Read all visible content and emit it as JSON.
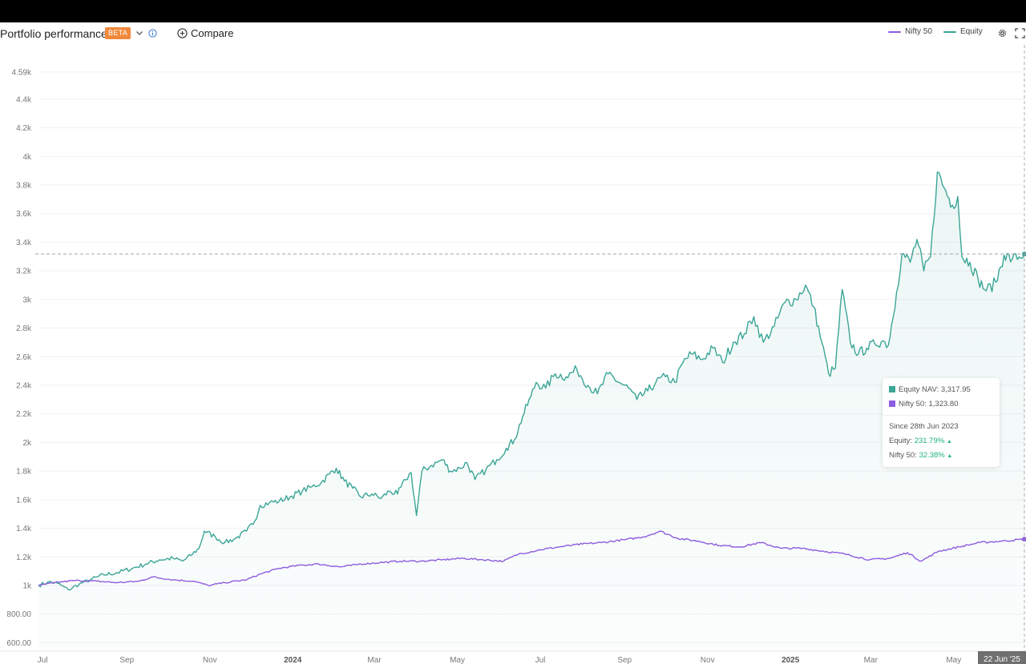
{
  "header": {
    "title": "Portfolio performance",
    "badge": "BETA",
    "compare_label": "Compare"
  },
  "legend": [
    {
      "name": "Nifty 50",
      "color": "#8e5cde"
    },
    {
      "name": "Equity",
      "color": "#3ba596"
    }
  ],
  "icons": {
    "dropdown": "chevron-down-icon",
    "info": "info-icon",
    "compare": "plus-circle-icon",
    "settings": "gear-icon",
    "fullscreen": "fullscreen-icon"
  },
  "tooltip": {
    "equity_label": "Equity NAV:",
    "equity_value": "3,317.95",
    "nifty_label": "Nifty 50:",
    "nifty_value": "1,323.80",
    "since_label": "Since 28th Jun 2023",
    "equity_return_label": "Equity:",
    "equity_return": "231.79%",
    "nifty_return_label": "Nifty 50:",
    "nifty_return": "32.38%",
    "up_arrow": "▲"
  },
  "chart_data": {
    "type": "line",
    "title": "",
    "xlabel": "",
    "ylabel": "",
    "ylim": [
      580,
      4650
    ],
    "x_range": [
      "2023-06-28",
      "2025-06-22"
    ],
    "y_ticks": [
      {
        "value": 600,
        "label": "600.00"
      },
      {
        "value": 800,
        "label": "800.00"
      },
      {
        "value": 1000,
        "label": "1k"
      },
      {
        "value": 1200,
        "label": "1.2k"
      },
      {
        "value": 1400,
        "label": "1.4k"
      },
      {
        "value": 1600,
        "label": "1.6k"
      },
      {
        "value": 1800,
        "label": "1.8k"
      },
      {
        "value": 2000,
        "label": "2k"
      },
      {
        "value": 2200,
        "label": "2.2k"
      },
      {
        "value": 2400,
        "label": "2.4k"
      },
      {
        "value": 2600,
        "label": "2.6k"
      },
      {
        "value": 2800,
        "label": "2.8k"
      },
      {
        "value": 3000,
        "label": "3k"
      },
      {
        "value": 3200,
        "label": "3.2k"
      },
      {
        "value": 3400,
        "label": "3.4k"
      },
      {
        "value": 3600,
        "label": "3.6k"
      },
      {
        "value": 3800,
        "label": "3.8k"
      },
      {
        "value": 4000,
        "label": "4k"
      },
      {
        "value": 4200,
        "label": "4.2k"
      },
      {
        "value": 4400,
        "label": "4.4k"
      },
      {
        "value": 4590,
        "label": "4.59k"
      }
    ],
    "x_ticks": [
      {
        "date": "2023-07-01",
        "label": "Jul",
        "bold": false
      },
      {
        "date": "2023-09-01",
        "label": "Sep",
        "bold": false
      },
      {
        "date": "2023-11-01",
        "label": "Nov",
        "bold": false
      },
      {
        "date": "2024-01-01",
        "label": "2024",
        "bold": true
      },
      {
        "date": "2024-03-01",
        "label": "Mar",
        "bold": false
      },
      {
        "date": "2024-05-01",
        "label": "May",
        "bold": false
      },
      {
        "date": "2024-07-01",
        "label": "Jul",
        "bold": false
      },
      {
        "date": "2024-09-01",
        "label": "Sep",
        "bold": false
      },
      {
        "date": "2024-11-01",
        "label": "Nov",
        "bold": false
      },
      {
        "date": "2025-01-01",
        "label": "2025",
        "bold": true
      },
      {
        "date": "2025-03-01",
        "label": "Mar",
        "bold": false
      },
      {
        "date": "2025-05-01",
        "label": "May",
        "bold": false
      }
    ],
    "crosshair": {
      "date": "2025-06-22",
      "label": "22 Jun '25",
      "value": 3317.95
    },
    "grid": true,
    "legend_position": "top-right",
    "series": [
      {
        "name": "Equity",
        "color": "#3ba596",
        "area": true,
        "points": [
          [
            "2023-06-28",
            1000
          ],
          [
            "2023-07-05",
            1025
          ],
          [
            "2023-07-12",
            1015
          ],
          [
            "2023-07-20",
            970
          ],
          [
            "2023-07-28",
            1010
          ],
          [
            "2023-08-05",
            1040
          ],
          [
            "2023-08-15",
            1075
          ],
          [
            "2023-08-25",
            1090
          ],
          [
            "2023-09-05",
            1120
          ],
          [
            "2023-09-15",
            1150
          ],
          [
            "2023-09-25",
            1180
          ],
          [
            "2023-10-05",
            1190
          ],
          [
            "2023-10-12",
            1170
          ],
          [
            "2023-10-18",
            1210
          ],
          [
            "2023-10-24",
            1260
          ],
          [
            "2023-10-28",
            1380
          ],
          [
            "2023-11-05",
            1340
          ],
          [
            "2023-11-12",
            1300
          ],
          [
            "2023-11-20",
            1330
          ],
          [
            "2023-11-28",
            1380
          ],
          [
            "2023-12-04",
            1450
          ],
          [
            "2023-12-08",
            1560
          ],
          [
            "2023-12-15",
            1580
          ],
          [
            "2023-12-22",
            1590
          ],
          [
            "2023-12-30",
            1620
          ],
          [
            "2024-01-08",
            1660
          ],
          [
            "2024-01-15",
            1690
          ],
          [
            "2024-01-22",
            1720
          ],
          [
            "2024-01-28",
            1780
          ],
          [
            "2024-02-02",
            1820
          ],
          [
            "2024-02-08",
            1730
          ],
          [
            "2024-02-14",
            1680
          ],
          [
            "2024-02-20",
            1620
          ],
          [
            "2024-02-28",
            1640
          ],
          [
            "2024-03-06",
            1610
          ],
          [
            "2024-03-12",
            1660
          ],
          [
            "2024-03-18",
            1640
          ],
          [
            "2024-03-24",
            1740
          ],
          [
            "2024-03-28",
            1790
          ],
          [
            "2024-04-01",
            1490
          ],
          [
            "2024-04-05",
            1800
          ],
          [
            "2024-04-12",
            1840
          ],
          [
            "2024-04-20",
            1880
          ],
          [
            "2024-04-26",
            1800
          ],
          [
            "2024-05-03",
            1820
          ],
          [
            "2024-05-08",
            1860
          ],
          [
            "2024-05-14",
            1740
          ],
          [
            "2024-05-22",
            1810
          ],
          [
            "2024-05-30",
            1880
          ],
          [
            "2024-06-06",
            1960
          ],
          [
            "2024-06-12",
            2020
          ],
          [
            "2024-06-18",
            2180
          ],
          [
            "2024-06-24",
            2320
          ],
          [
            "2024-06-28",
            2420
          ],
          [
            "2024-07-05",
            2380
          ],
          [
            "2024-07-12",
            2480
          ],
          [
            "2024-07-20",
            2460
          ],
          [
            "2024-07-28",
            2510
          ],
          [
            "2024-08-05",
            2400
          ],
          [
            "2024-08-12",
            2340
          ],
          [
            "2024-08-20",
            2480
          ],
          [
            "2024-08-28",
            2420
          ],
          [
            "2024-09-04",
            2380
          ],
          [
            "2024-09-10",
            2300
          ],
          [
            "2024-09-18",
            2360
          ],
          [
            "2024-09-24",
            2420
          ],
          [
            "2024-10-01",
            2460
          ],
          [
            "2024-10-08",
            2420
          ],
          [
            "2024-10-14",
            2560
          ],
          [
            "2024-10-20",
            2620
          ],
          [
            "2024-10-28",
            2580
          ],
          [
            "2024-11-05",
            2660
          ],
          [
            "2024-11-12",
            2560
          ],
          [
            "2024-11-20",
            2700
          ],
          [
            "2024-11-28",
            2760
          ],
          [
            "2024-12-05",
            2880
          ],
          [
            "2024-12-12",
            2700
          ],
          [
            "2024-12-20",
            2810
          ],
          [
            "2024-12-28",
            2980
          ],
          [
            "2025-01-05",
            3000
          ],
          [
            "2025-01-12",
            3100
          ],
          [
            "2025-01-18",
            2950
          ],
          [
            "2025-01-24",
            2700
          ],
          [
            "2025-01-29",
            2480
          ],
          [
            "2025-02-03",
            2520
          ],
          [
            "2025-02-08",
            3070
          ],
          [
            "2025-02-14",
            2700
          ],
          [
            "2025-02-20",
            2620
          ],
          [
            "2025-02-26",
            2660
          ],
          [
            "2025-03-04",
            2690
          ],
          [
            "2025-03-10",
            2710
          ],
          [
            "2025-03-14",
            2680
          ],
          [
            "2025-03-20",
            3050
          ],
          [
            "2025-03-24",
            3320
          ],
          [
            "2025-03-30",
            3260
          ],
          [
            "2025-04-04",
            3420
          ],
          [
            "2025-04-09",
            3200
          ],
          [
            "2025-04-14",
            3300
          ],
          [
            "2025-04-19",
            3890
          ],
          [
            "2025-04-24",
            3780
          ],
          [
            "2025-04-30",
            3660
          ],
          [
            "2025-05-04",
            3720
          ],
          [
            "2025-05-07",
            3300
          ],
          [
            "2025-05-13",
            3260
          ],
          [
            "2025-05-19",
            3140
          ],
          [
            "2025-05-25",
            3060
          ],
          [
            "2025-06-01",
            3120
          ],
          [
            "2025-06-07",
            3310
          ],
          [
            "2025-06-13",
            3280
          ],
          [
            "2025-06-22",
            3317.95
          ]
        ]
      },
      {
        "name": "Nifty 50",
        "color": "#8e5cde",
        "area": false,
        "points": [
          [
            "2023-06-28",
            1000
          ],
          [
            "2023-07-10",
            1020
          ],
          [
            "2023-07-25",
            1035
          ],
          [
            "2023-08-10",
            1030
          ],
          [
            "2023-08-25",
            1020
          ],
          [
            "2023-09-10",
            1030
          ],
          [
            "2023-09-20",
            1060
          ],
          [
            "2023-10-05",
            1040
          ],
          [
            "2023-10-20",
            1030
          ],
          [
            "2023-10-31",
            1000
          ],
          [
            "2023-11-12",
            1020
          ],
          [
            "2023-11-28",
            1040
          ],
          [
            "2023-12-08",
            1080
          ],
          [
            "2023-12-22",
            1120
          ],
          [
            "2024-01-05",
            1140
          ],
          [
            "2024-01-20",
            1150
          ],
          [
            "2024-02-05",
            1130
          ],
          [
            "2024-02-20",
            1150
          ],
          [
            "2024-03-05",
            1160
          ],
          [
            "2024-03-20",
            1170
          ],
          [
            "2024-04-05",
            1170
          ],
          [
            "2024-04-20",
            1180
          ],
          [
            "2024-05-05",
            1190
          ],
          [
            "2024-05-20",
            1180
          ],
          [
            "2024-06-04",
            1170
          ],
          [
            "2024-06-15",
            1220
          ],
          [
            "2024-07-01",
            1250
          ],
          [
            "2024-07-15",
            1270
          ],
          [
            "2024-08-01",
            1290
          ],
          [
            "2024-08-15",
            1300
          ],
          [
            "2024-09-01",
            1320
          ],
          [
            "2024-09-15",
            1340
          ],
          [
            "2024-09-27",
            1380
          ],
          [
            "2024-10-10",
            1330
          ],
          [
            "2024-10-25",
            1310
          ],
          [
            "2024-11-10",
            1280
          ],
          [
            "2024-11-25",
            1270
          ],
          [
            "2024-12-10",
            1300
          ],
          [
            "2024-12-25",
            1260
          ],
          [
            "2025-01-10",
            1260
          ],
          [
            "2025-01-25",
            1240
          ],
          [
            "2025-02-10",
            1220
          ],
          [
            "2025-02-28",
            1180
          ],
          [
            "2025-03-15",
            1190
          ],
          [
            "2025-03-28",
            1230
          ],
          [
            "2025-04-07",
            1170
          ],
          [
            "2025-04-20",
            1240
          ],
          [
            "2025-05-05",
            1270
          ],
          [
            "2025-05-20",
            1300
          ],
          [
            "2025-06-05",
            1310
          ],
          [
            "2025-06-22",
            1323.8
          ]
        ]
      }
    ]
  }
}
